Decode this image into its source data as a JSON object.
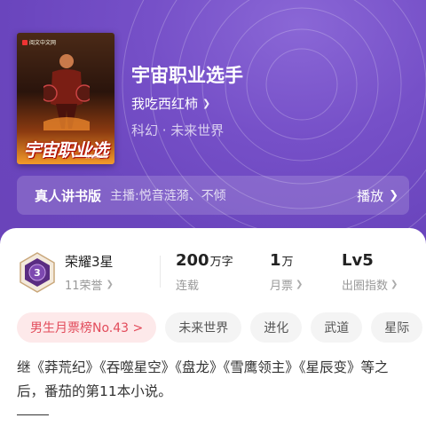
{
  "book": {
    "title": "宇宙职业选手",
    "author": "我吃西红柿",
    "genre": "科幻 · 未来世界",
    "cover": {
      "title_art": "宇宙职业选手",
      "publisher_mark": "阅文中文网",
      "author_mark": "我吃西红柿"
    }
  },
  "narration": {
    "label": "真人讲书版",
    "hosts": "主播:悦音涟漪、不倾",
    "play_label": "播放"
  },
  "honor": {
    "name": "荣耀3星",
    "sub": "11荣誉",
    "badge_number": "3"
  },
  "stats": [
    {
      "value": "200",
      "unit": "万字",
      "label": "连载"
    },
    {
      "value": "1",
      "unit": "万",
      "label": "月票"
    },
    {
      "value": "Lv5",
      "unit": "",
      "label": "出圈指数"
    }
  ],
  "tags": {
    "rank": "男生月票榜No.43 >",
    "items": [
      "未来世界",
      "进化",
      "武道",
      "星际"
    ]
  },
  "intro": "继《莽荒纪》《吞噬星空》《盘龙》《雪鹰领主》《星辰变》等之后，番茄的第11本小说。",
  "colors": {
    "hero_bg": "#7650c8",
    "rank_tag_text": "#e24b5b",
    "rank_tag_bg": "#fde9ea",
    "badge_purple": "#5a2c82"
  }
}
